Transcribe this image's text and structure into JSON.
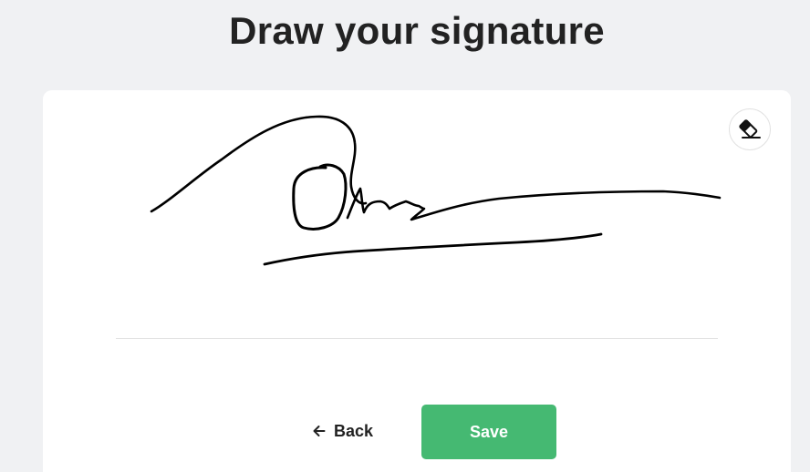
{
  "header": {
    "title": "Draw your signature"
  },
  "signature_pad": {
    "clear_icon": "eraser-icon",
    "stroke_color": "#000000"
  },
  "actions": {
    "back_label": "Back",
    "back_icon": "arrow-left-icon",
    "save_label": "Save"
  },
  "colors": {
    "background": "#f0f1f3",
    "card": "#ffffff",
    "save_button": "#45b972",
    "title_text": "#222222"
  }
}
